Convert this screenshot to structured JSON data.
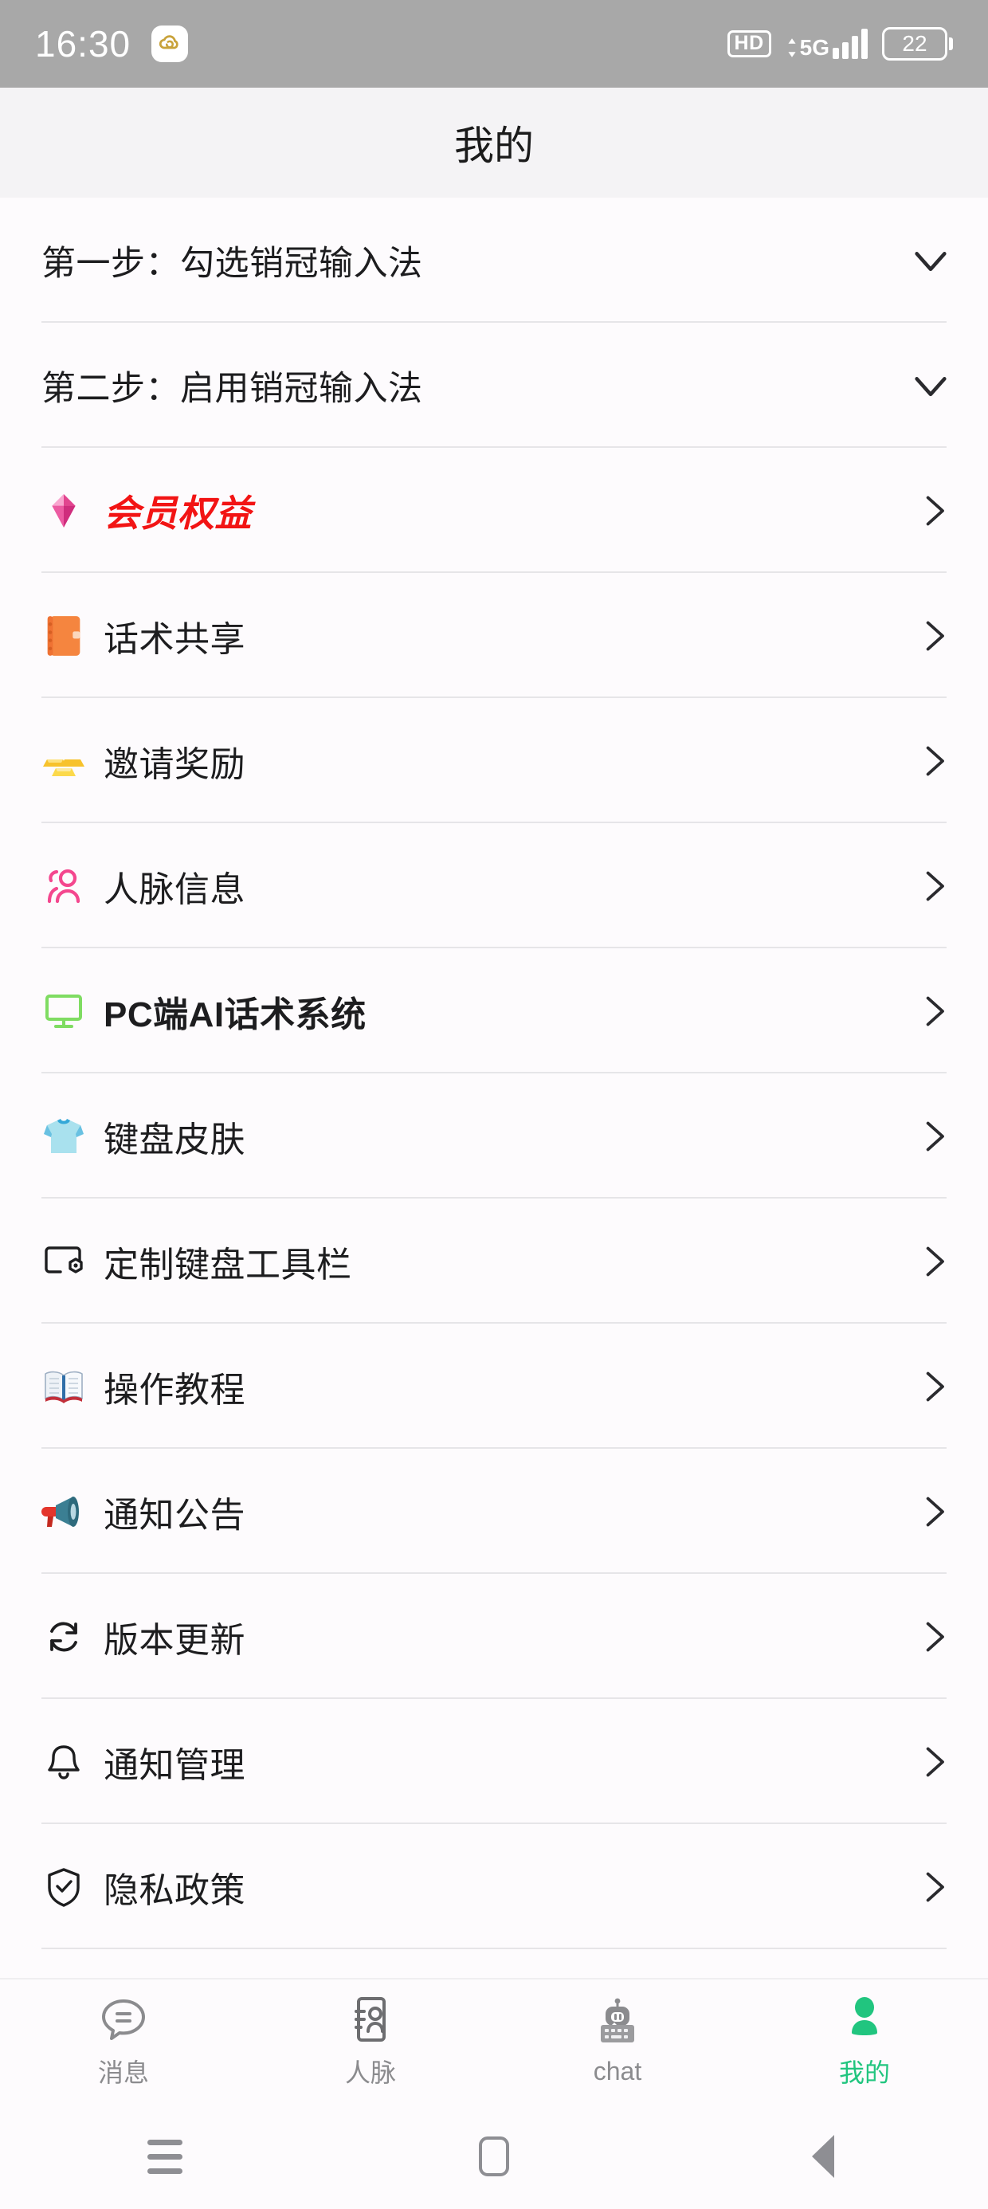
{
  "status_bar": {
    "time": "16:30",
    "app_icon": "cloud-sync-icon",
    "hd_label": "HD",
    "network_label": "5G",
    "signal_bars": 4,
    "battery_level": "22"
  },
  "header": {
    "title": "我的"
  },
  "list": {
    "items": [
      {
        "id": "step-one",
        "label": "第一步：勾选销冠输入法",
        "icon": "none",
        "accessory": "chevron-down-icon",
        "style": "step"
      },
      {
        "id": "step-two",
        "label": "第二步：启用销冠输入法",
        "icon": "none",
        "accessory": "chevron-down-icon",
        "style": "step"
      },
      {
        "id": "member-benefits",
        "label": "会员权益",
        "icon": "gem-icon",
        "accessory": "chevron-right-icon",
        "style": "vip"
      },
      {
        "id": "script-sharing",
        "label": "话术共享",
        "icon": "notebook-icon",
        "accessory": "chevron-right-icon",
        "style": "normal"
      },
      {
        "id": "invite-reward",
        "label": "邀请奖励",
        "icon": "gold-bars-icon",
        "accessory": "chevron-right-icon",
        "style": "normal"
      },
      {
        "id": "contacts-info",
        "label": "人脉信息",
        "icon": "people-icon",
        "accessory": "chevron-right-icon",
        "style": "normal"
      },
      {
        "id": "pc-ai-script",
        "label": "PC端AI话术系统",
        "icon": "monitor-icon",
        "accessory": "chevron-right-icon",
        "style": "bold"
      },
      {
        "id": "keyboard-skin",
        "label": "键盘皮肤",
        "icon": "tshirt-icon",
        "accessory": "chevron-right-icon",
        "style": "normal"
      },
      {
        "id": "custom-toolbar",
        "label": "定制键盘工具栏",
        "icon": "toolbar-icon",
        "accessory": "chevron-right-icon",
        "style": "normal"
      },
      {
        "id": "tutorial",
        "label": "操作教程",
        "icon": "open-book-icon",
        "accessory": "chevron-right-icon",
        "style": "normal"
      },
      {
        "id": "announcements",
        "label": "通知公告",
        "icon": "megaphone-icon",
        "accessory": "chevron-right-icon",
        "style": "normal"
      },
      {
        "id": "version-update",
        "label": "版本更新",
        "icon": "refresh-icon",
        "accessory": "chevron-right-icon",
        "style": "normal"
      },
      {
        "id": "notification-mgmt",
        "label": "通知管理",
        "icon": "bell-icon",
        "accessory": "chevron-right-icon",
        "style": "normal"
      },
      {
        "id": "privacy-policy",
        "label": "隐私政策",
        "icon": "shield-check-icon",
        "accessory": "chevron-right-icon",
        "style": "normal"
      }
    ]
  },
  "tabbar": {
    "items": [
      {
        "id": "messages",
        "label": "消息",
        "icon": "chat-bubble-icon",
        "active": false
      },
      {
        "id": "contacts",
        "label": "人脉",
        "icon": "contact-card-icon",
        "active": false
      },
      {
        "id": "chat",
        "label": "chat",
        "icon": "robot-keyboard-icon",
        "active": false
      },
      {
        "id": "mine",
        "label": "我的",
        "icon": "person-icon",
        "active": true
      }
    ],
    "active_color": "#21c57f",
    "inactive_color": "#8b8b8e"
  },
  "system_nav": {
    "items": [
      {
        "id": "recents",
        "icon": "menu-lines-icon"
      },
      {
        "id": "home",
        "icon": "home-square-icon"
      },
      {
        "id": "back",
        "icon": "back-triangle-icon"
      }
    ]
  },
  "colors": {
    "status_bar_bg": "#a8a8a8",
    "title_bar_bg": "#f4f3f5",
    "page_bg": "#fdfbfd",
    "separator": "#e6e5e8",
    "vip_red": "#f21414",
    "accent_green": "#21c57f"
  }
}
